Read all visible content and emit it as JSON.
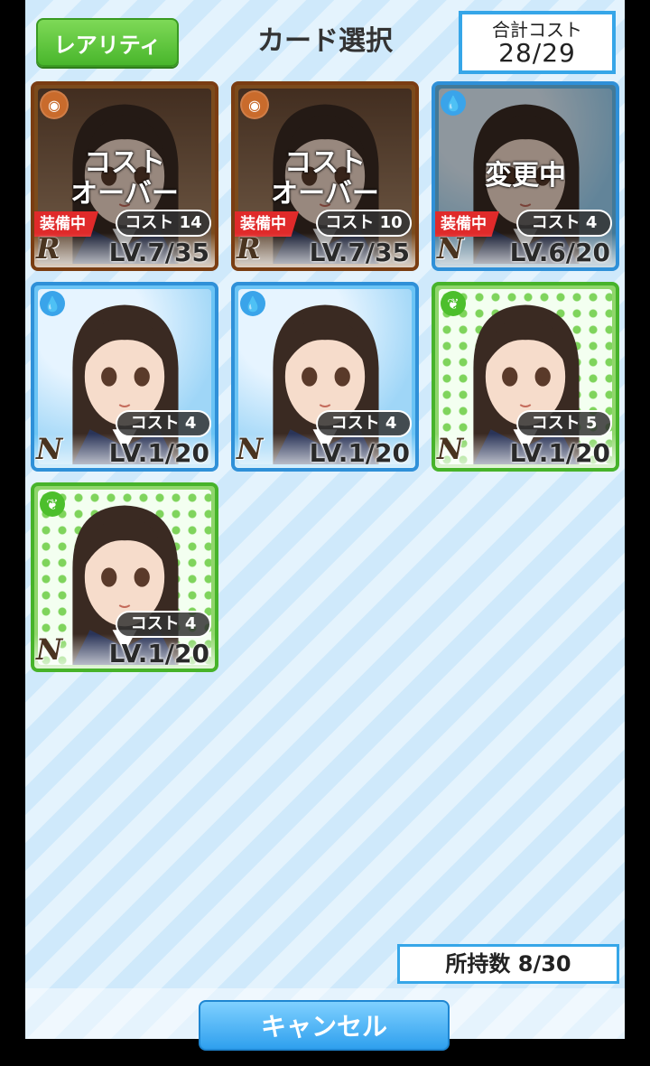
{
  "header": {
    "rarity_button": "レアリティ",
    "title": "カード選択",
    "total_cost_label": "合計コスト",
    "total_cost_value": "28/29"
  },
  "cards": [
    {
      "rarity": "R",
      "overlay": [
        "コスト",
        "オーバー"
      ],
      "equipped": "装備中",
      "cost": "コスト 14",
      "level": "LV.7/35",
      "attribute_icon": "flame-icon"
    },
    {
      "rarity": "R",
      "overlay": [
        "コスト",
        "オーバー"
      ],
      "equipped": "装備中",
      "cost": "コスト 10",
      "level": "LV.7/35",
      "attribute_icon": "flame-icon"
    },
    {
      "rarity": "N",
      "overlay": [
        "変更中"
      ],
      "equipped": "装備中",
      "cost": "コスト 4",
      "level": "LV.6/20",
      "attribute_icon": "water-drop-icon"
    },
    {
      "rarity": "N",
      "cost": "コスト 4",
      "level": "LV.1/20",
      "attribute_icon": "water-drop-icon"
    },
    {
      "rarity": "N",
      "cost": "コスト 4",
      "level": "LV.1/20",
      "attribute_icon": "water-drop-icon"
    },
    {
      "rarity": "N",
      "cost": "コスト 5",
      "level": "LV.1/20",
      "attribute_icon": "leaf-icon"
    },
    {
      "rarity": "N",
      "cost": "コスト 4",
      "level": "LV.1/20",
      "attribute_icon": "leaf-icon"
    }
  ],
  "footer": {
    "owned_count": "所持数 8/30",
    "cancel_button": "キャンセル"
  }
}
